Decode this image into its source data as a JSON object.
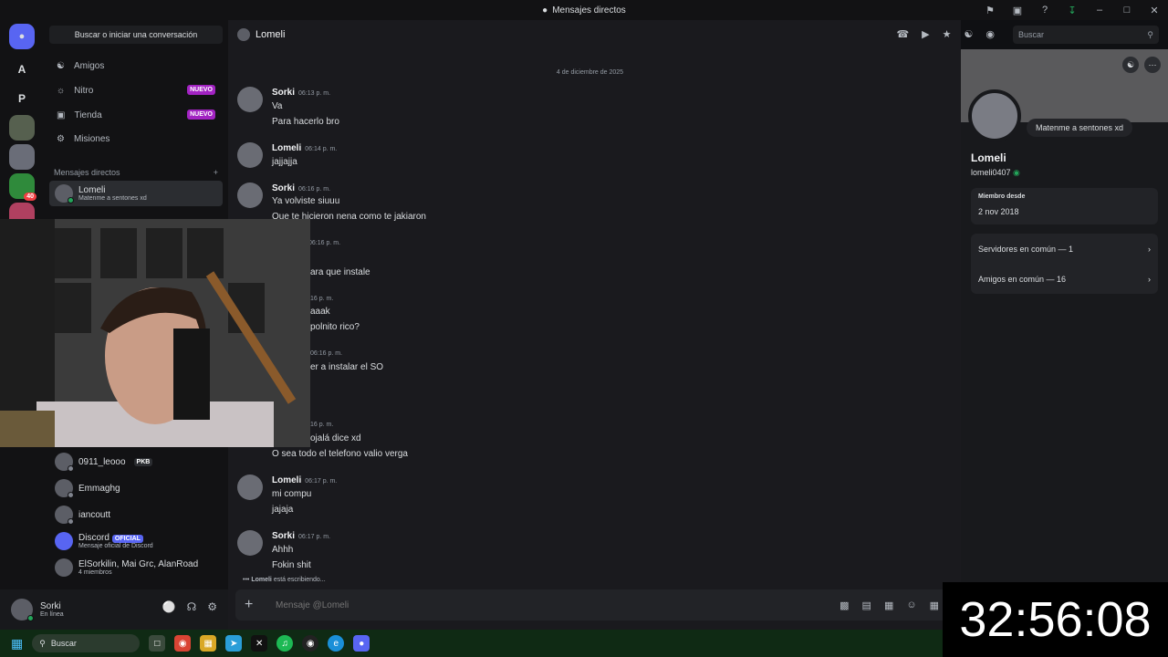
{
  "window": {
    "title": "Mensajes directos"
  },
  "rail": {
    "items": [
      {
        "label": "A"
      },
      {
        "label": "P"
      },
      {
        "label": "",
        "badge": "40"
      }
    ]
  },
  "sidebar": {
    "search_label": "Buscar o iniciar una conversación",
    "nav": [
      {
        "label": "Amigos",
        "icon": "friends-icon"
      },
      {
        "label": "Nitro",
        "badge": "NUEVO",
        "icon": "nitro-icon"
      },
      {
        "label": "Tienda",
        "badge": "NUEVO",
        "icon": "shop-icon"
      },
      {
        "label": "Misiones",
        "icon": "quests-icon"
      }
    ],
    "dm_header": "Mensajes directos",
    "dms": [
      {
        "name": "Lomeli",
        "sub": "Matenme a sentones xd"
      },
      {
        "name": "0911_leooo",
        "tag": "PKB"
      },
      {
        "name": "Emmaghg"
      },
      {
        "name": "iancoutt"
      },
      {
        "name": "Discord",
        "tag": "OFICIAL",
        "sub": "Mensaje oficial de Discord"
      },
      {
        "name": "ElSorkilin, Mai Grc, AlanRoad",
        "sub": "4 miembros"
      }
    ]
  },
  "user_panel": {
    "name": "Sorki",
    "status": "En línea"
  },
  "chat": {
    "header_name": "Lomeli",
    "search_placeholder": "Buscar",
    "date_divider": "4 de diciembre de 2025",
    "messages": [
      {
        "author": "Sorki",
        "time": "06:13 p. m.",
        "lines": [
          "Va",
          "Para hacerlo bro"
        ]
      },
      {
        "author": "Lomeli",
        "time": "06:14 p. m.",
        "lines": [
          "jajjajja"
        ]
      },
      {
        "author": "Sorki",
        "time": "06:16 p. m.",
        "lines": [
          "Ya volviste siuuu",
          "Que te hicieron nena como te jakiaron"
        ]
      },
      {
        "author": "",
        "time": "06:16 p. m.",
        "lines": [
          "ara que instale"
        ]
      },
      {
        "author": "",
        "time": "16 p. m.",
        "lines": [
          "aaak",
          "polnito rico?"
        ]
      },
      {
        "author": "",
        "time": "06:16 p. m.",
        "lines": [
          "er a instalar el SO"
        ]
      },
      {
        "author": "",
        "time": "16 p. m.",
        "lines": [
          "ojalá dice xd",
          "O sea todo el telefono valio verga"
        ]
      },
      {
        "author": "Lomeli",
        "time": "06:17 p. m.",
        "lines": [
          "mi compu",
          "jajaja"
        ]
      },
      {
        "author": "Sorki",
        "time": "06:17 p. m.",
        "lines": [
          "Ahhh",
          "Fokin shit"
        ]
      }
    ],
    "typing": {
      "name": "Lomeli",
      "text": "está escribiendo..."
    },
    "composer_placeholder": "Mensaje @Lomeli"
  },
  "profile": {
    "status_text": "Matenme a sentones xd",
    "name": "Lomeli",
    "username": "lomeli0407",
    "member_since_label": "Miembro desde",
    "member_since": "2 nov 2018",
    "servers_common": "Servidores en común — 1",
    "friends_common": "Amigos en común — 16"
  },
  "overlay": {
    "timer": "32:56:08"
  },
  "taskbar": {
    "search_label": "Buscar"
  }
}
